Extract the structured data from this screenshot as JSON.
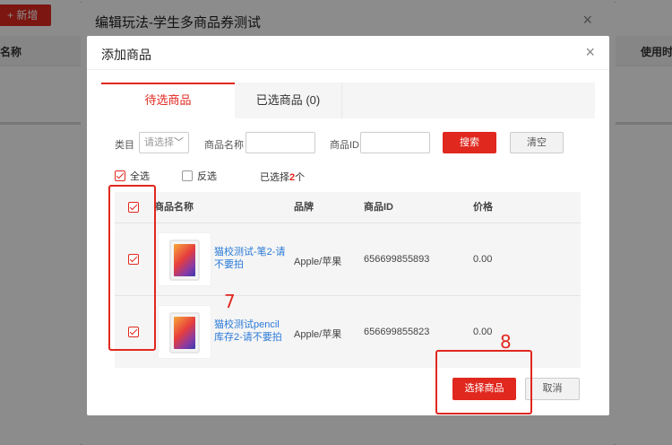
{
  "background": {
    "add_button": "+ 新增",
    "col_name": "名称",
    "col_time": "使用时间"
  },
  "outer_dialog": {
    "title": "编辑玩法-学生多商品券测试",
    "close": "×"
  },
  "dialog": {
    "title": "添加商品",
    "close": "×",
    "tabs": [
      {
        "label": "待选商品",
        "active": true
      },
      {
        "label": "已选商品 (0)",
        "active": false
      }
    ],
    "filter": {
      "category_label": "类目",
      "category_placeholder": "请选择",
      "name_label": "商品名称",
      "name_value": "",
      "id_label": "商品ID",
      "id_value": "",
      "search_button": "搜索",
      "clear_button": "清空"
    },
    "selection": {
      "select_all_label": "全选",
      "select_all_checked": true,
      "invert_label": "反选",
      "invert_checked": false,
      "selected_prefix": "已选择",
      "selected_count": "2",
      "selected_suffix": "个"
    },
    "table": {
      "headers": [
        "商品名称",
        "品牌",
        "商品ID",
        "价格"
      ],
      "rows": [
        {
          "name": "猫校测试-笔2-请不要拍",
          "brand": "Apple/苹果",
          "id": "656699855893",
          "price": "0.00",
          "checked": true
        },
        {
          "name": "猫校测试pencil库存2-请不要拍",
          "brand": "Apple/苹果",
          "id": "656699855823",
          "price": "0.00",
          "checked": true
        }
      ]
    },
    "footer": {
      "choose_button": "选择商品",
      "cancel_button": "取消"
    }
  },
  "annotations": {
    "step_7": "7",
    "step_8": "8"
  },
  "colors": {
    "accent": "#e0281f",
    "link": "#2a7ad8"
  }
}
